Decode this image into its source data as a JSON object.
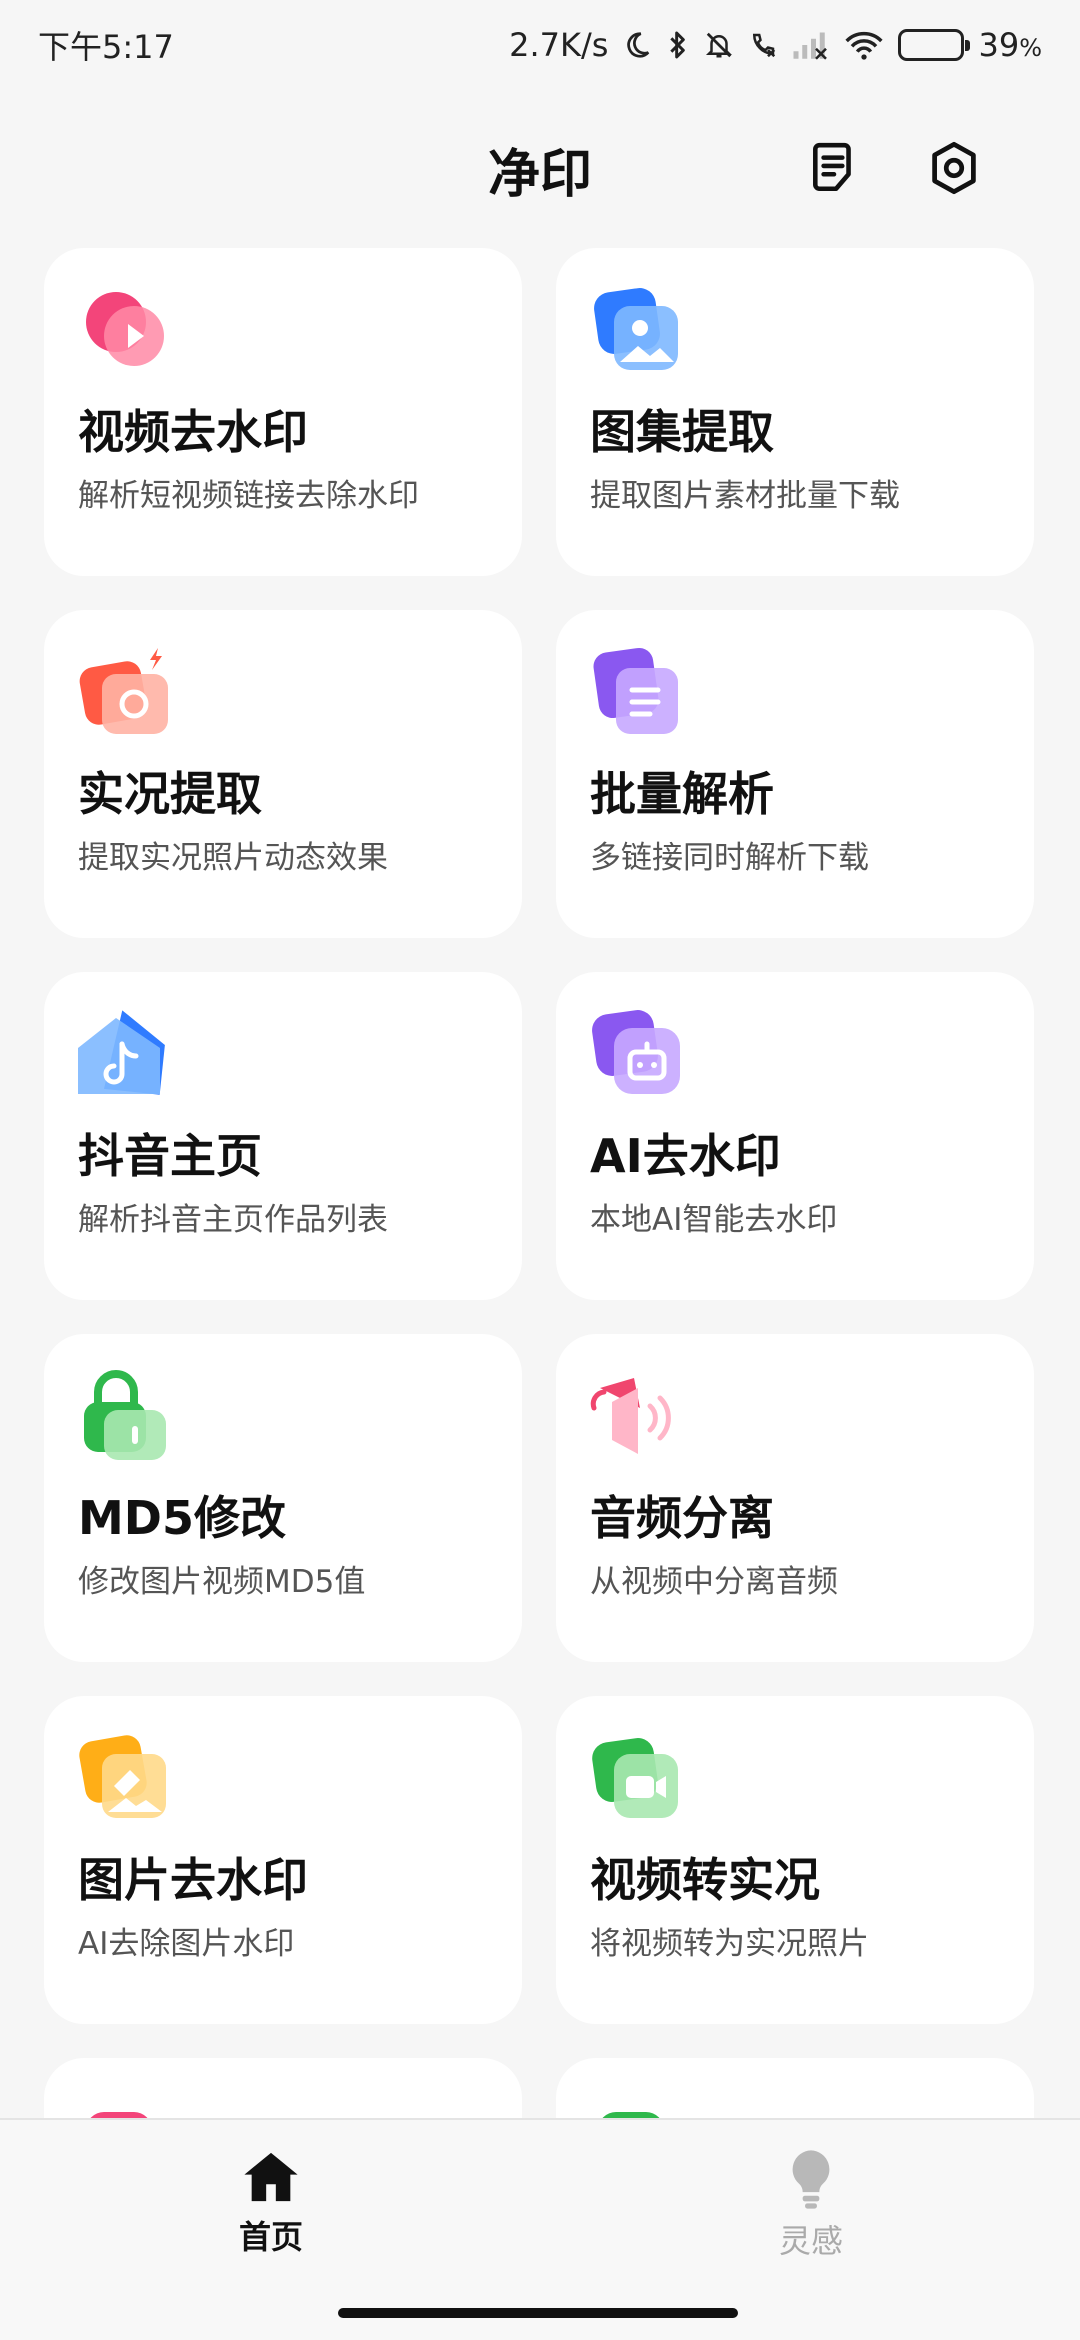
{
  "status_bar": {
    "time": "下午5:17",
    "net_speed": "2.7K/s",
    "battery_level": 0.39,
    "battery_text": "39",
    "battery_unit": "%"
  },
  "header": {
    "title": "净印",
    "notes_icon": "notes-icon",
    "settings_icon": "settings-hex-icon"
  },
  "features": [
    {
      "title": "视频去水印",
      "subtitle": "解析短视频链接去除水印",
      "icon": "video-play-icon",
      "color": "#f0466e"
    },
    {
      "title": "图集提取",
      "subtitle": "提取图片素材批量下载",
      "icon": "image-gallery-icon",
      "color": "#2f86ff"
    },
    {
      "title": "实况提取",
      "subtitle": "提取实况照片动态效果",
      "icon": "live-photo-camera-icon",
      "color": "#ff6a4d"
    },
    {
      "title": "批量解析",
      "subtitle": "多链接同时解析下载",
      "icon": "batch-document-icon",
      "color": "#8e5cf0"
    },
    {
      "title": "抖音主页",
      "subtitle": "解析抖音主页作品列表",
      "icon": "douyin-home-icon",
      "color": "#2f86ff"
    },
    {
      "title": "AI去水印",
      "subtitle": "本地AI智能去水印",
      "icon": "ai-robot-icon",
      "color": "#8e5cf0"
    },
    {
      "title": "MD5修改",
      "subtitle": "修改图片视频MD5值",
      "icon": "lock-icon",
      "color": "#3fc45a"
    },
    {
      "title": "音频分离",
      "subtitle": "从视频中分离音频",
      "icon": "speaker-icon",
      "color": "#f06a8c"
    },
    {
      "title": "图片去水印",
      "subtitle": "AI去除图片水印",
      "icon": "image-eraser-icon",
      "color": "#ffb020"
    },
    {
      "title": "视频转实况",
      "subtitle": "将视频转为实况照片",
      "icon": "video-camera-icon",
      "color": "#3fc45a"
    },
    {
      "title": "",
      "subtitle": "",
      "icon": "partial-pink-icon",
      "color": "#f0466e"
    },
    {
      "title": "",
      "subtitle": "",
      "icon": "partial-green-icon",
      "color": "#3fc45a"
    }
  ],
  "bottom_nav": {
    "items": [
      {
        "label": "首页",
        "icon": "home-icon",
        "active": true
      },
      {
        "label": "灵感",
        "icon": "lightbulb-icon",
        "active": false
      }
    ]
  }
}
